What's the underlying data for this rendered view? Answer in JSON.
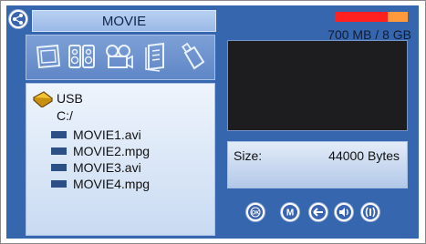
{
  "header": {
    "title": "MOVIE"
  },
  "capacity": {
    "text": "700 MB / 8 GB",
    "used_fraction": 0.72,
    "used_color": "#ff2020",
    "free_color": "#ff9a3c"
  },
  "categories": [
    {
      "icon": "photo-frame-icon"
    },
    {
      "icon": "speakers-icon"
    },
    {
      "icon": "film-reels-icon"
    },
    {
      "icon": "document-icon"
    },
    {
      "icon": "usb-plug-icon"
    }
  ],
  "browser": {
    "device_label": "USB",
    "path": "C:/",
    "files": [
      "MOVIE1.avi",
      "MOVIE2.mpg",
      "MOVIE3.avi",
      "MOVIE4.mpg"
    ]
  },
  "info": {
    "size_label": "Size:",
    "size_value": "44000 Bytes"
  },
  "controls": [
    {
      "icon": "ok-icon",
      "text": "OK"
    },
    {
      "icon": "menu-icon",
      "text": "M"
    },
    {
      "icon": "back-arrow-icon"
    },
    {
      "icon": "volume-icon"
    },
    {
      "icon": "sound-mode-icon"
    }
  ],
  "colors": {
    "background": "#3666ae",
    "icon_blue": "#3a64b2"
  }
}
